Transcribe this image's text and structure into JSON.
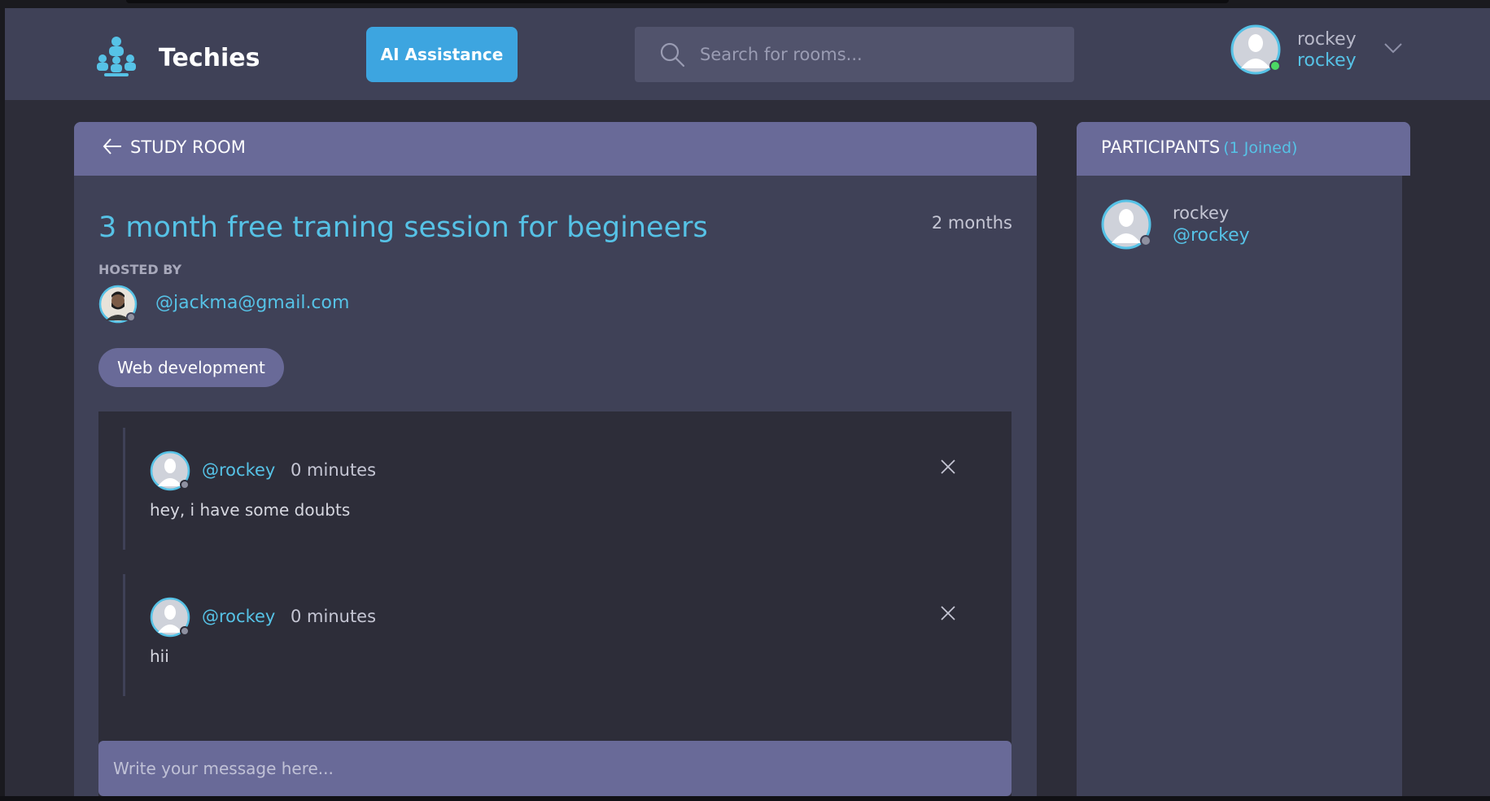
{
  "header": {
    "brand": "Techies",
    "ai_button": "AI Assistance",
    "search_placeholder": "Search for rooms...",
    "user": {
      "name": "rockey",
      "handle": "rockey",
      "status": "online"
    }
  },
  "room": {
    "section_label": "STUDY ROOM",
    "title": "3 month free traning session for begineers",
    "age": "2 months",
    "hosted_by_label": "HOSTED BY",
    "host": "@jackma@gmail.com",
    "topic": "Web development",
    "messages": [
      {
        "author": "@rockey",
        "time": "0 minutes",
        "body": "hey, i have some doubts"
      },
      {
        "author": "@rockey",
        "time": "0 minutes",
        "body": "hii"
      }
    ],
    "composer_placeholder": "Write your message here..."
  },
  "participants": {
    "title": "PARTICIPANTS",
    "count_label": "(1 Joined)",
    "list": [
      {
        "name": "rockey",
        "handle": "@rockey"
      }
    ]
  },
  "colors": {
    "accent": "#56c2e6",
    "button": "#3da5e0",
    "panel": "#3f4157",
    "panel_header": "#696a98",
    "background": "#2d2d39"
  }
}
